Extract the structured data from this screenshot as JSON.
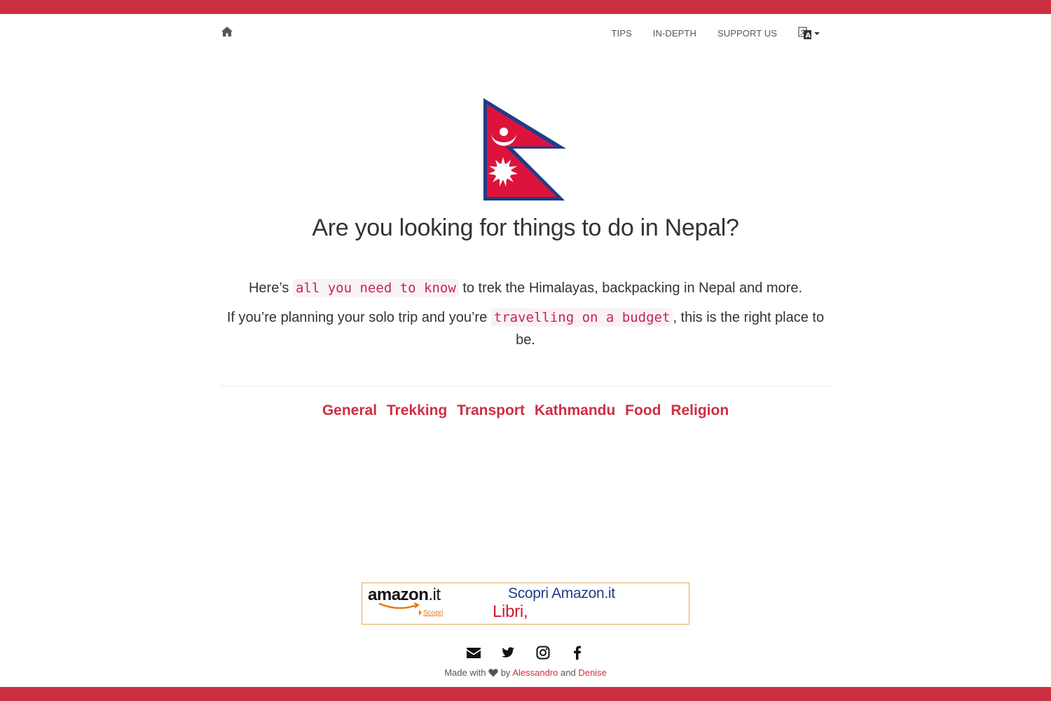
{
  "colors": {
    "brand_red": "#cd2f42",
    "text": "#333333",
    "code_red": "#c7254e",
    "code_bg": "#f9f2f4",
    "flag_blue": "#1f3c88",
    "amazon_orange": "#e47911"
  },
  "nav": {
    "home_icon": "home-icon",
    "items": [
      {
        "label": "TIPS"
      },
      {
        "label": "IN-DEPTH"
      },
      {
        "label": "SUPPORT US"
      }
    ],
    "language_icon": "translate-icon"
  },
  "hero": {
    "flag": "nepal-flag",
    "headline": "Are you looking for things to do in Nepal?"
  },
  "intro": {
    "line1_before": "Here’s ",
    "line1_code": "all you need to know",
    "line1_after": " to trek the Himalayas, backpacking in Nepal and more.",
    "line2_before": "If you’re planning your solo trip and you’re ",
    "line2_code": "travelling on a budget",
    "line2_after": ", this is the right place to be."
  },
  "categories": [
    {
      "label": "General"
    },
    {
      "label": "Trekking"
    },
    {
      "label": "Transport"
    },
    {
      "label": "Kathmandu"
    },
    {
      "label": "Food"
    },
    {
      "label": "Religion"
    }
  ],
  "ad": {
    "logo_main": "amazon",
    "logo_tld": ".it",
    "discover_link": "Scopri",
    "headline": "Scopri Amazon.it",
    "subline": "Libri,"
  },
  "social": [
    {
      "icon": "envelope-icon"
    },
    {
      "icon": "twitter-icon"
    },
    {
      "icon": "instagram-icon"
    },
    {
      "icon": "facebook-icon"
    }
  ],
  "footer": {
    "made_with": "Made with",
    "by": "by",
    "author1": "Alessandro",
    "and": "and",
    "author2": "Denise"
  }
}
